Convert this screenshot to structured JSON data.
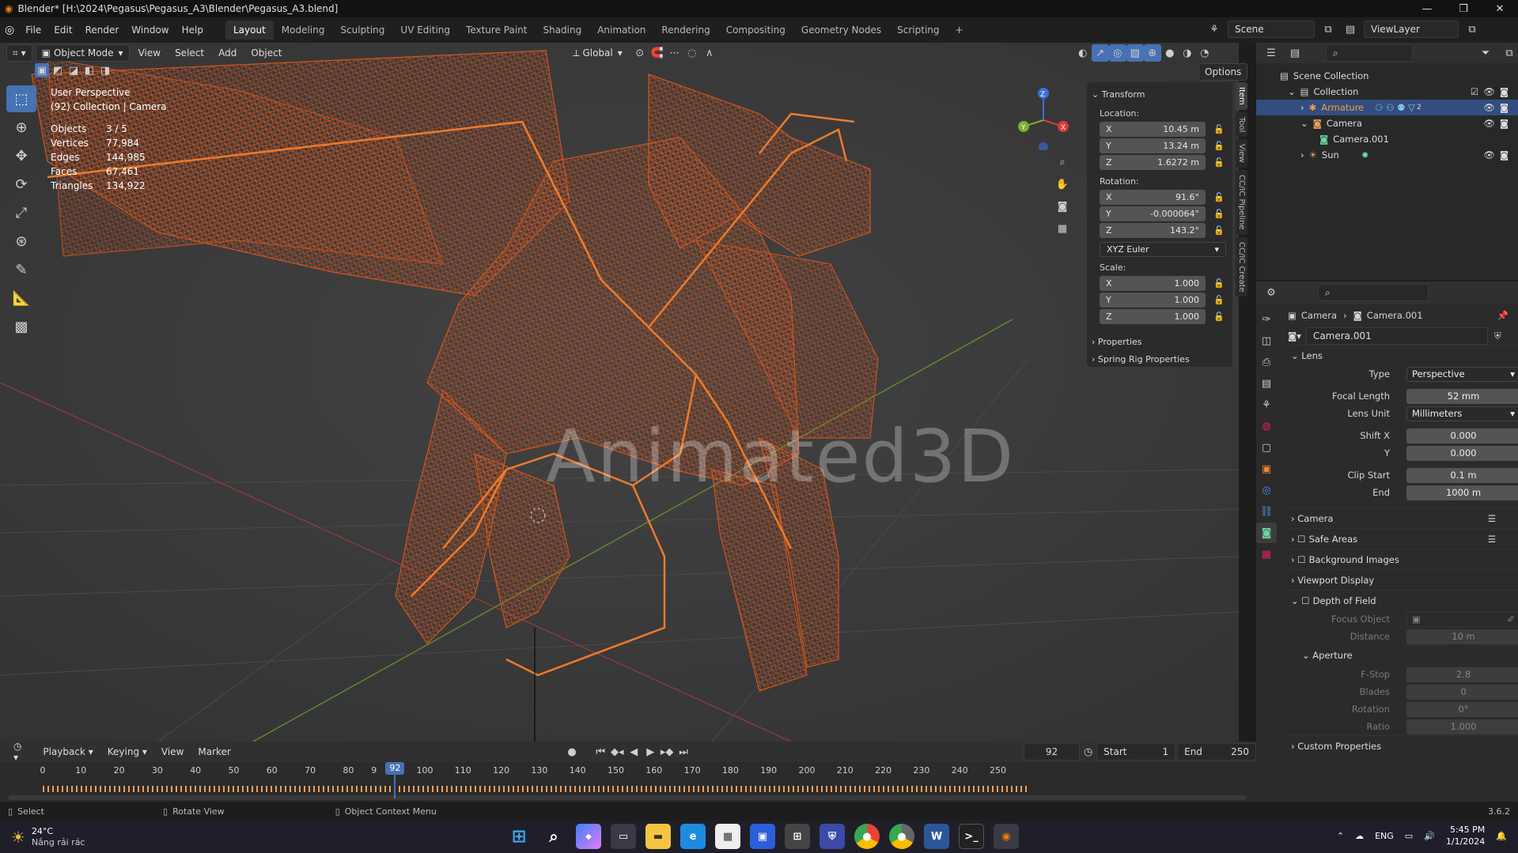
{
  "window": {
    "title": "Blender* [H:\\2024\\Pegasus\\Pegasus_A3\\Blender\\Pegasus_A3.blend]",
    "controls": [
      "—",
      "❐",
      "✕"
    ]
  },
  "menubar": {
    "menus": [
      "File",
      "Edit",
      "Render",
      "Window",
      "Help"
    ],
    "workspaces": [
      "Layout",
      "Modeling",
      "Sculpting",
      "UV Editing",
      "Texture Paint",
      "Shading",
      "Animation",
      "Rendering",
      "Compositing",
      "Geometry Nodes",
      "Scripting"
    ],
    "active_workspace": "Layout",
    "add_tab": "+",
    "scene": "Scene",
    "view_layer": "ViewLayer"
  },
  "viewport_header": {
    "mode": "Object Mode",
    "menus": [
      "View",
      "Select",
      "Add",
      "Object"
    ],
    "orientation": "Global",
    "options": "Options"
  },
  "viewport": {
    "view_name": "User Perspective",
    "collection_line": "(92) Collection | Camera",
    "stats": [
      {
        "label": "Objects",
        "value": "3 / 5"
      },
      {
        "label": "Vertices",
        "value": "77,984"
      },
      {
        "label": "Edges",
        "value": "144,985"
      },
      {
        "label": "Faces",
        "value": "67,461"
      },
      {
        "label": "Triangles",
        "value": "134,922"
      }
    ],
    "watermark": "Animated3D",
    "gizmo_axes": {
      "x": "X",
      "y": "Y",
      "z": "Z"
    },
    "accent_wire": "#d2541f",
    "accent_select": "#4772b3"
  },
  "n_panel": {
    "transform_title": "Transform",
    "location_label": "Location:",
    "location": [
      {
        "axis": "X",
        "value": "10.45 m"
      },
      {
        "axis": "Y",
        "value": "13.24 m"
      },
      {
        "axis": "Z",
        "value": "1.6272 m"
      }
    ],
    "rotation_label": "Rotation:",
    "rotation": [
      {
        "axis": "X",
        "value": "91.6°"
      },
      {
        "axis": "Y",
        "value": "-0.000064°"
      },
      {
        "axis": "Z",
        "value": "143.2°"
      }
    ],
    "rotation_mode": "XYZ Euler",
    "scale_label": "Scale:",
    "scale": [
      {
        "axis": "X",
        "value": "1.000"
      },
      {
        "axis": "Y",
        "value": "1.000"
      },
      {
        "axis": "Z",
        "value": "1.000"
      }
    ],
    "properties": "Properties",
    "spring_rig": "Spring Rig Properties",
    "tabs": [
      "Item",
      "Tool",
      "View",
      "CC/IC Pipeline",
      "CC/IC Create"
    ]
  },
  "outliner": {
    "root": "Scene Collection",
    "items": [
      {
        "name": "Collection",
        "indent": 1
      },
      {
        "name": "Armature",
        "indent": 2
      },
      {
        "name": "Camera",
        "indent": 2
      },
      {
        "name": "Camera.001",
        "indent": 3
      },
      {
        "name": "Sun",
        "indent": 2
      }
    ],
    "armature_suffix": "2"
  },
  "properties": {
    "breadcrumb_object": "Camera",
    "breadcrumb_data": "Camera.001",
    "data_name": "Camera.001",
    "lens_title": "Lens",
    "type_label": "Type",
    "type_value": "Perspective",
    "focal_label": "Focal Length",
    "focal_value": "52 mm",
    "lens_unit_label": "Lens Unit",
    "lens_unit_value": "Millimeters",
    "shift_x_label": "Shift X",
    "shift_x_value": "0.000",
    "shift_y_label": "Y",
    "shift_y_value": "0.000",
    "clip_start_label": "Clip Start",
    "clip_start_value": "0.1 m",
    "clip_end_label": "End",
    "clip_end_value": "1000 m",
    "subpanels": [
      "Camera",
      "Safe Areas",
      "Background Images",
      "Viewport Display"
    ],
    "dof_title": "Depth of Field",
    "focus_object_label": "Focus Object",
    "distance_label": "Distance",
    "distance_value": "10 m",
    "aperture_title": "Aperture",
    "fstop_label": "F-Stop",
    "fstop_value": "2.8",
    "blades_label": "Blades",
    "blades_value": "0",
    "rotation_label": "Rotation",
    "rotation_value": "0°",
    "ratio_label": "Ratio",
    "ratio_value": "1.000",
    "custom_props": "Custom Properties"
  },
  "timeline": {
    "menus": [
      "Playback",
      "Keying",
      "View",
      "Marker"
    ],
    "current_frame": "92",
    "start_label": "Start",
    "start_value": "1",
    "end_label": "End",
    "end_value": "250",
    "ticks": [
      "0",
      "10",
      "20",
      "30",
      "40",
      "50",
      "60",
      "70",
      "80",
      "9",
      "100",
      "110",
      "120",
      "130",
      "140",
      "150",
      "160",
      "170",
      "180",
      "190",
      "200",
      "210",
      "220",
      "230",
      "240",
      "250"
    ]
  },
  "statusbar": {
    "hints": [
      "Select",
      "Rotate View",
      "Object Context Menu"
    ],
    "version": "3.6.2"
  },
  "taskbar": {
    "weather_temp": "24°C",
    "weather_text": "Nắng rải rác",
    "lang": "ENG",
    "time": "5:45 PM",
    "date": "1/1/2024",
    "apps": [
      "start",
      "search",
      "copilot",
      "taskview",
      "explorer",
      "edge",
      "app-grid",
      "store",
      "office",
      "shield",
      "chrome",
      "chrome-dev",
      "word",
      "terminal",
      "blender"
    ]
  }
}
